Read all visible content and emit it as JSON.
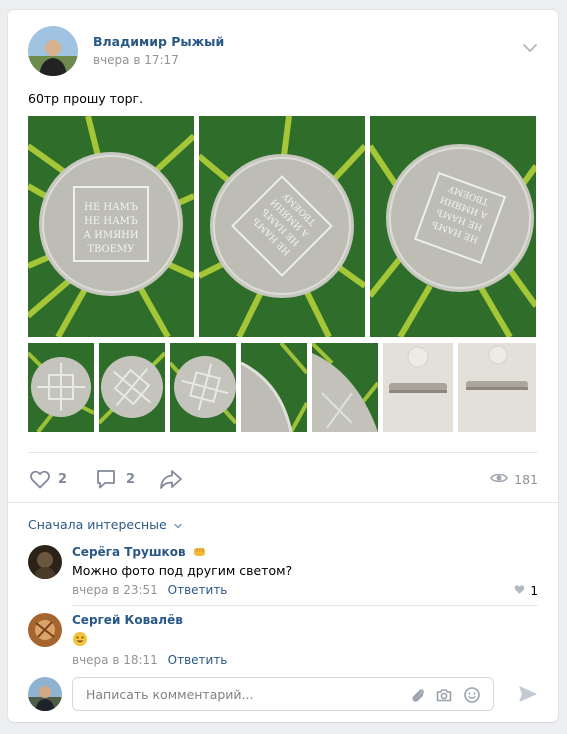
{
  "post": {
    "author": "Владимир Рыжый",
    "time": "вчера в 17:17",
    "text": "60тр прошу торг.",
    "photos_main": [
      {
        "label": "НЕ НАМЪ НЕ НАМЪ А ИМЯНИ ТВОЕМУ",
        "variant": "obverse-1"
      },
      {
        "label": "НЕ НАМЪ НЕ НАМЪ А ИМЯНИ ТВОЕМУ",
        "variant": "obverse-2"
      },
      {
        "label": "НЕ НАМЪ НЕ НАМЪ А ИМЯНИ ТВОЕМУ",
        "variant": "obverse-3"
      }
    ],
    "photos_small": [
      {
        "variant": "reverse-1"
      },
      {
        "variant": "reverse-2"
      },
      {
        "variant": "reverse-3"
      },
      {
        "variant": "edge-1"
      },
      {
        "variant": "edge-2"
      },
      {
        "variant": "edge-grey-1"
      },
      {
        "variant": "edge-grey-2"
      }
    ]
  },
  "actions": {
    "likes": "2",
    "comments": "2",
    "views": "181"
  },
  "comments_sort": "Сначала интересные",
  "comments": [
    {
      "author": "Серёга Трушков",
      "badge_icon": "fist-emoji",
      "text": "Можно фото под другим светом?",
      "time": "вчера в 23:51",
      "reply": "Ответить",
      "likes": "1"
    },
    {
      "author": "Сергей Ковалёв",
      "text_icon": "smile-emoji",
      "time": "вчера в 18:11",
      "reply": "Ответить"
    }
  ],
  "reply_box": {
    "placeholder": "Написать комментарий..."
  },
  "colors": {
    "link": "#2a5885",
    "muted": "#939393",
    "icon": "#828a99",
    "background": "#edeef0"
  }
}
